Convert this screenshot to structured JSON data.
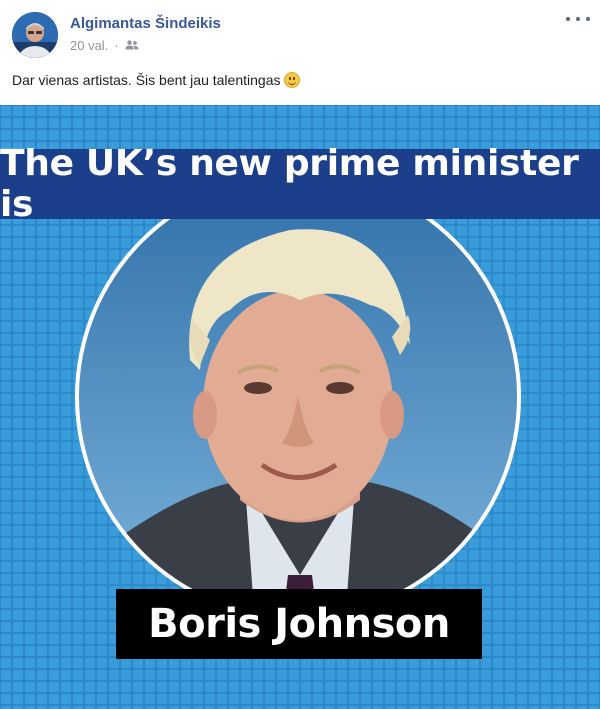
{
  "post": {
    "author": "Algimantas Šindeikis",
    "time": "20 val.",
    "separator": "·",
    "audience_icon": "friends-icon",
    "more_icon": "more-options-icon",
    "text": "Dar vienas artistas. Šis bent jau talentingas",
    "emoji": "smiley-emoji-icon"
  },
  "image": {
    "headline": "The UK’s new prime minister is",
    "name": "Boris Johnson",
    "colors": {
      "background": "#2f8fcf",
      "headline_band": "#1b3f8a",
      "name_box": "#000000",
      "text": "#ffffff"
    }
  }
}
